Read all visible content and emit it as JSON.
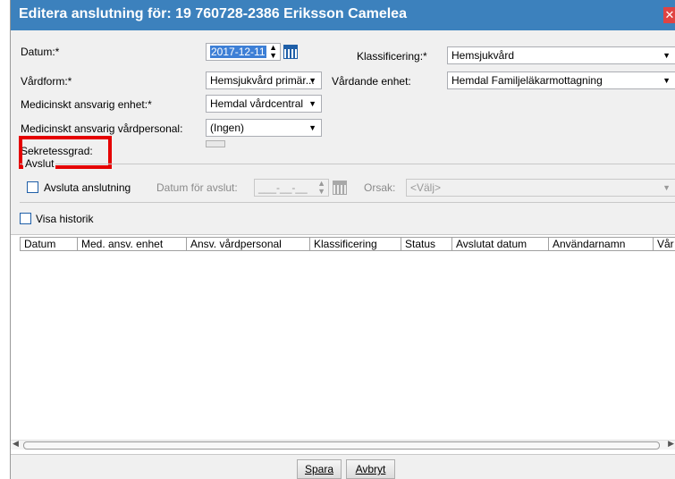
{
  "window": {
    "title": "Editera anslutning för: 19 760728-2386 Eriksson Camelea",
    "close_glyph": "✕"
  },
  "form": {
    "datum_label": "Datum:*",
    "datum_value": "2017-12-11",
    "klassificering_label": "Klassificering:*",
    "klassificering_value": "Hemsjukvård",
    "vardform_label": "Vårdform:*",
    "vardform_value": "Hemsjukvård primär...",
    "vardande_enhet_label": "Vårdande enhet:",
    "vardande_enhet_value": "Hemdal Familjeläkarmottagning",
    "med_enhet_label": "Medicinskt ansvarig enhet:*",
    "med_enhet_value": "Hemdal vårdcentral",
    "med_personal_label": "Medicinskt ansvarig vårdpersonal:",
    "med_personal_value": "(Ingen)",
    "sekretess_label": "Sekretessgrad:"
  },
  "avslut": {
    "section_label": "Avslut",
    "checkbox_label": "Avsluta anslutning",
    "datum_label": "Datum för avslut:",
    "datum_value": "___-__-__",
    "orsak_label": "Orsak:",
    "orsak_value": "<Välj>"
  },
  "historik": {
    "checkbox_label": "Visa historik",
    "columns": [
      "Datum",
      "Med. ansv. enhet",
      "Ansv. vårdpersonal",
      "Klassificering",
      "Status",
      "Avslutat datum",
      "Användarnamn",
      "Vår"
    ]
  },
  "buttons": {
    "spara": "Spara",
    "avbryt": "Avbryt"
  },
  "colors": {
    "title_bar": "#3c81bd",
    "highlight": "#e50000",
    "selection": "#3d7fd6"
  }
}
